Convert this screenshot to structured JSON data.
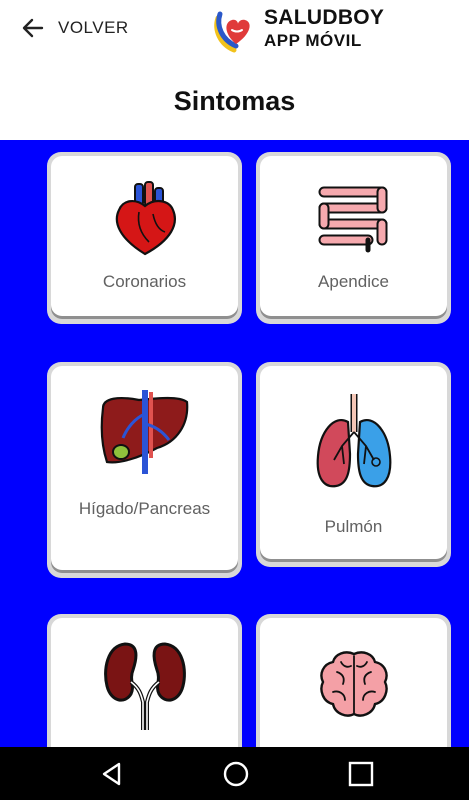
{
  "header": {
    "back_label": "VOLVER",
    "logo_name": "SALUDBOY",
    "logo_subtitle": "APP MÓVIL"
  },
  "page": {
    "title": "Sintomas"
  },
  "cards": [
    {
      "label": "Coronarios",
      "icon": "heart-icon"
    },
    {
      "label": "Apendice",
      "icon": "intestine-icon"
    },
    {
      "label": "Hígado/Pancreas",
      "icon": "liver-icon"
    },
    {
      "label": "Pulmón",
      "icon": "lungs-icon"
    },
    {
      "label": "",
      "icon": "kidneys-icon"
    },
    {
      "label": "",
      "icon": "brain-icon"
    }
  ],
  "colors": {
    "background": "#0000ff",
    "card": "#ffffff",
    "label_text": "#616161"
  },
  "navbar": {
    "icons": [
      "back-triangle-icon",
      "home-circle-icon",
      "recents-square-icon"
    ]
  }
}
